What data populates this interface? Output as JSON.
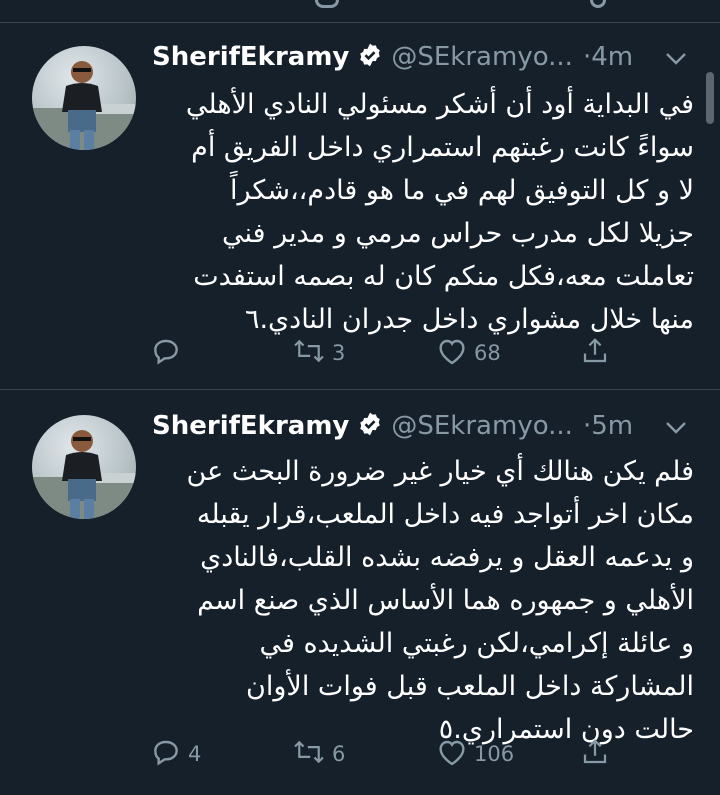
{
  "colors": {
    "background": "#15202b",
    "text": "#ffffff",
    "muted": "#8899a6",
    "divider": "#38444d"
  },
  "tweets": [
    {
      "author_name": "SherifEkramy",
      "handle": "@SEkramyo...",
      "time": "·4m",
      "text": "في البداية أود أن أشكر مسئولي النادي الأهلي\nسواءً كانت رغبتهم استمراري داخل الفريق أم\nلا و كل التوفيق لهم في ما هو قادم،،شكراً\nجزيلا لكل مدرب حراس مرمي و مدير فني\nتعاملت معه،فكل منكم كان له بصمه استفدت\nمنها خلال مشواري داخل جدران النادي.٦",
      "reply_count": "",
      "retweet_count": "3",
      "like_count": "68"
    },
    {
      "author_name": "SherifEkramy",
      "handle": "@SEkramyo...",
      "time": "·5m",
      "text": "فلم يكن هنالك أي خيار غير ضرورة البحث عن\nمكان اخر أتواجد فيه داخل الملعب،قرار يقبله\nو يدعمه العقل و يرفضه بشده القلب،فالنادي\nالأهلي و جمهوره هما الأساس الذي صنع اسم\nو عائلة إكرامي،لكن رغبتي الشديده في\nالمشاركة داخل الملعب قبل فوات الأوان\nحالت دون استمراري.٥",
      "reply_count": "4",
      "retweet_count": "6",
      "like_count": "106"
    }
  ]
}
